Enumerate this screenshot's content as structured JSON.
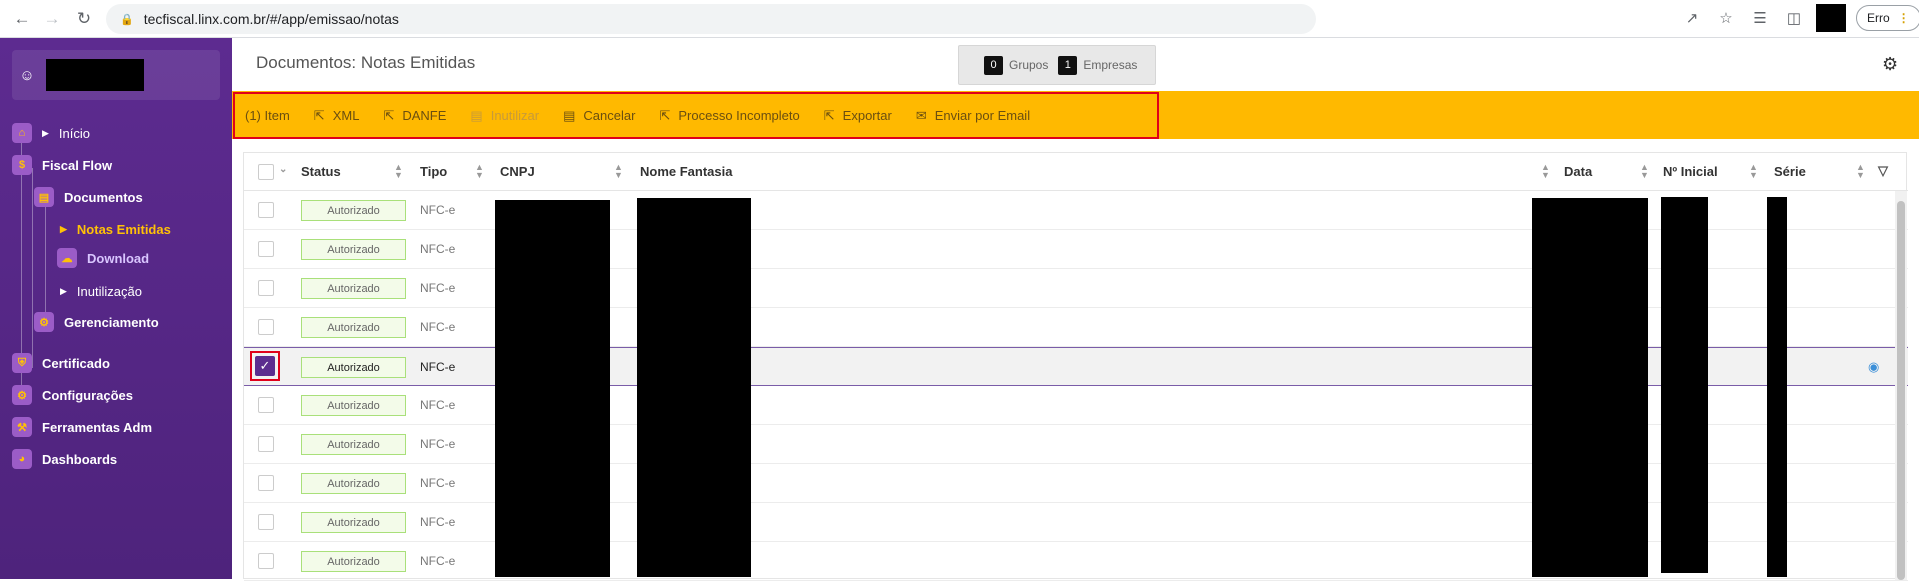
{
  "browser": {
    "url": "tecfiscal.linx.com.br/#/app/emissao/notas",
    "error_label": "Erro"
  },
  "sidebar": {
    "items": [
      {
        "label": "Início"
      },
      {
        "label": "Fiscal Flow"
      },
      {
        "label": "Documentos"
      },
      {
        "label": "Notas Emitidas"
      },
      {
        "label": "Download"
      },
      {
        "label": "Inutilização"
      },
      {
        "label": "Gerenciamento"
      },
      {
        "label": "Certificado"
      },
      {
        "label": "Configurações"
      },
      {
        "label": "Ferramentas Adm"
      },
      {
        "label": "Dashboards"
      }
    ]
  },
  "header": {
    "title": "Documentos: Notas Emitidas",
    "groups_count": "0",
    "groups_label": "Grupos",
    "companies_count": "1",
    "companies_label": "Empresas"
  },
  "toolbar": {
    "selected_count": "(1) Item",
    "xml": "XML",
    "danfe": "DANFE",
    "inutilizar": "Inutilizar",
    "cancelar": "Cancelar",
    "processo_incompleto": "Processo Incompleto",
    "exportar": "Exportar",
    "enviar_email": "Enviar por Email"
  },
  "table": {
    "columns": [
      "Status",
      "Tipo",
      "CNPJ",
      "Nome Fantasia",
      "Data",
      "Nº Inicial",
      "Série"
    ],
    "rows": [
      {
        "status": "Autorizado",
        "tipo": "NFC-e",
        "selected": false
      },
      {
        "status": "Autorizado",
        "tipo": "NFC-e",
        "selected": false
      },
      {
        "status": "Autorizado",
        "tipo": "NFC-e",
        "selected": false
      },
      {
        "status": "Autorizado",
        "tipo": "NFC-e",
        "selected": false
      },
      {
        "status": "Autorizado",
        "tipo": "NFC-e",
        "selected": true
      },
      {
        "status": "Autorizado",
        "tipo": "NFC-e",
        "selected": false
      },
      {
        "status": "Autorizado",
        "tipo": "NFC-e",
        "selected": false
      },
      {
        "status": "Autorizado",
        "tipo": "NFC-e",
        "selected": false
      },
      {
        "status": "Autorizado",
        "tipo": "NFC-e",
        "selected": false
      },
      {
        "status": "Autorizado",
        "tipo": "NFC-e",
        "selected": false
      }
    ]
  },
  "colors": {
    "sidebar": "#5d2b90",
    "toolbar": "#ffb900",
    "accent": "#ffc107",
    "highlight": "#e0001a"
  }
}
